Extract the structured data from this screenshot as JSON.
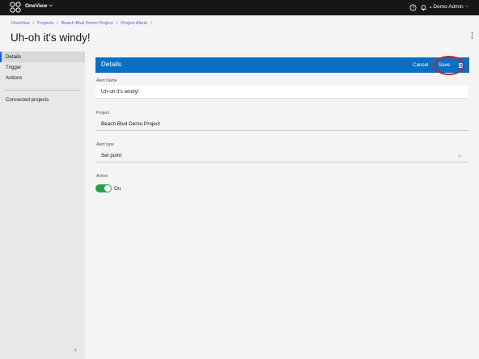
{
  "topbar": {
    "product_name": "OneView",
    "product_chevron": "⌵",
    "user_name": "Demo Admin",
    "user_chevron": "⌵"
  },
  "breadcrumb": {
    "items": [
      "OneView",
      "Projects",
      "Beach Blvd Demo Project",
      "Project Alerts"
    ],
    "separator": "/"
  },
  "page": {
    "title": "Uh-oh it's windy!"
  },
  "sidebar": {
    "items": [
      {
        "label": "Details",
        "active": true
      },
      {
        "label": "Trigger",
        "active": false
      },
      {
        "label": "Actions",
        "active": false
      },
      {
        "label": "Connected projects",
        "active": false
      }
    ],
    "collapse_glyph": "‹"
  },
  "panel": {
    "title": "Details",
    "cancel_label": "Cancel",
    "save_label": "Save"
  },
  "form": {
    "alert_name": {
      "label": "Alert Name",
      "value": "Uh-oh it's windy!"
    },
    "project": {
      "label": "Project",
      "value": "Beach Blvd Demo Project"
    },
    "alert_type": {
      "label": "Alert type",
      "value": "Set point"
    },
    "active": {
      "label": "Active",
      "state_label": "On",
      "on": true
    }
  },
  "colors": {
    "topbar": "#161616",
    "panel_header": "#0a6fc2",
    "link": "#8a3ffc",
    "toggle_on": "#24a148",
    "highlight_ring": "#c0262b"
  },
  "icons": {
    "logo": "oneview-logo-icon",
    "help": "help-icon",
    "notifications": "bell-icon",
    "overflow": "overflow-menu-icon",
    "save": "save-icon",
    "select": "chevron-down-icon",
    "collapse": "collapse-sidebar-icon"
  }
}
